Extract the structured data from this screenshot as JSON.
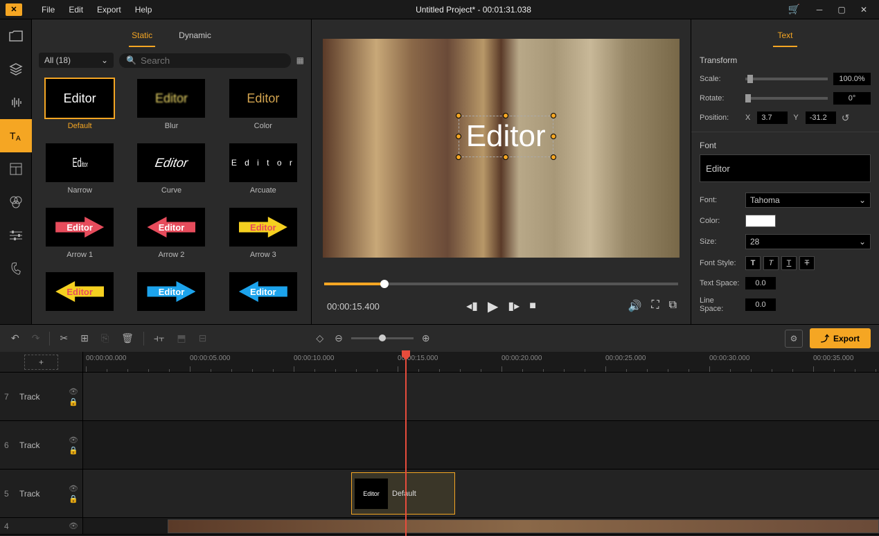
{
  "app": {
    "title": "Untitled Project* - 00:01:31.038"
  },
  "menu": {
    "file": "File",
    "edit": "Edit",
    "export": "Export",
    "help": "Help"
  },
  "library": {
    "tabs": {
      "static": "Static",
      "dynamic": "Dynamic"
    },
    "filter": "All (18)",
    "search_placeholder": "Search",
    "presets": [
      {
        "label": "Default"
      },
      {
        "label": "Blur"
      },
      {
        "label": "Color"
      },
      {
        "label": "Narrow"
      },
      {
        "label": "Curve"
      },
      {
        "label": "Arcuate"
      },
      {
        "label": "Arrow 1"
      },
      {
        "label": "Arrow 2"
      },
      {
        "label": "Arrow 3"
      },
      {
        "label": ""
      },
      {
        "label": ""
      },
      {
        "label": ""
      }
    ],
    "sample_text": "Editor"
  },
  "preview": {
    "overlay_text": "Editor",
    "current_time": "00:00:15.400"
  },
  "props": {
    "tab": "Text",
    "transform": {
      "header": "Transform",
      "scale_label": "Scale:",
      "scale_value": "100.0%",
      "rotate_label": "Rotate:",
      "rotate_value": "0°",
      "position_label": "Position:",
      "x_label": "X",
      "x_value": "3.7",
      "y_label": "Y",
      "y_value": "-31.2"
    },
    "font": {
      "header": "Font",
      "text_value": "Editor",
      "font_label": "Font:",
      "font_value": "Tahoma",
      "color_label": "Color:",
      "size_label": "Size:",
      "size_value": "28",
      "style_label": "Font Style:",
      "space_label": "Text Space:",
      "space_value": "0.0",
      "line_label": "Line Space:",
      "line_value": "0.0"
    }
  },
  "timeline": {
    "export_label": "Export",
    "marks": [
      "00:00:00.000",
      "00:00:05.000",
      "00:00:10.000",
      "00:00:15.000",
      "00:00:20.000",
      "00:00:25.000",
      "00:00:30.000",
      "00:00:35.000"
    ],
    "tracks": [
      {
        "num": "7",
        "label": "Track"
      },
      {
        "num": "6",
        "label": "Track"
      },
      {
        "num": "5",
        "label": "Track"
      },
      {
        "num": "4",
        "label": ""
      }
    ],
    "clip_label": "Default",
    "clip_thumb_text": "Editor"
  }
}
